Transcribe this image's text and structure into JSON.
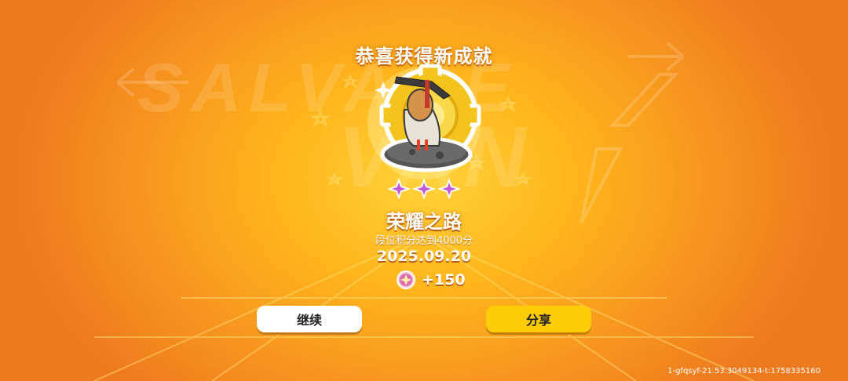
{
  "header": {
    "title": "恭喜获得新成就"
  },
  "achievement": {
    "stars": 3,
    "name": "荣耀之路",
    "description": "段位积分达到4000分",
    "date": "2025.09.20",
    "reward": {
      "icon": "gem-coin-icon",
      "amount": "+150"
    }
  },
  "buttons": {
    "continue_label": "继续",
    "share_label": "分享"
  },
  "footer": {
    "build_id": "1-gfqsyf-21.53.3049134-t:1758335160"
  },
  "background": {
    "logo_line1": "SALVAGE",
    "logo_line2": "VAN"
  },
  "colors": {
    "accent_yellow": "#ffcc0a",
    "background_orange": "#f7951f",
    "text_white": "#ffffff"
  }
}
